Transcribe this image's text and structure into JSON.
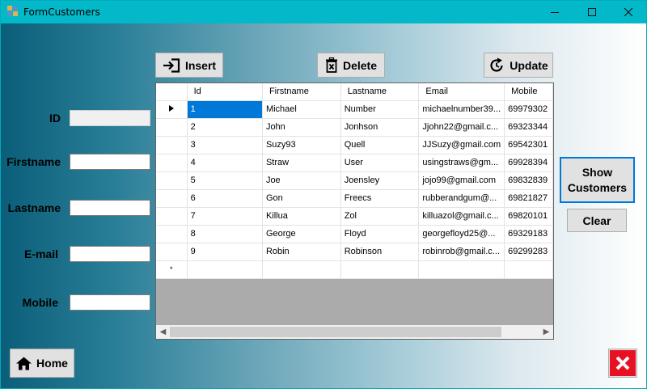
{
  "window": {
    "title": "FormCustomers",
    "accent_color": "#02b8c9",
    "controls": [
      "minimize-icon",
      "maximize-icon",
      "close-icon"
    ]
  },
  "form": {
    "labels": {
      "id": "ID",
      "firstname": "Firstname",
      "lastname": "Lastname",
      "email": "E-mail",
      "mobile": "Mobile"
    },
    "values": {
      "id": "",
      "firstname": "",
      "lastname": "",
      "email": "",
      "mobile": ""
    }
  },
  "toolbar": {
    "insert_label": "Insert",
    "delete_label": "Delete",
    "update_label": "Update"
  },
  "side": {
    "show_customers_line1": "Show",
    "show_customers_line2": "Customers",
    "clear_label": "Clear"
  },
  "footer": {
    "home_label": "Home",
    "exit_color": "#e81123"
  },
  "grid": {
    "columns": [
      "Id",
      "Firstname",
      "Lastname",
      "Email",
      "Mobile"
    ],
    "rows": [
      [
        "1",
        "Michael",
        "Number",
        "michaelnumber39...",
        "69979302"
      ],
      [
        "2",
        "John",
        "Jonhson",
        "Jjohn22@gmail.c...",
        "69323344"
      ],
      [
        "3",
        "Suzy93",
        "Quell",
        "JJSuzy@gmail.com",
        "69542301"
      ],
      [
        "4",
        "Straw",
        "User",
        "usingstraws@gm...",
        "69928394"
      ],
      [
        "5",
        "Joe",
        "Joensley",
        "jojo99@gmail.com",
        "69832839"
      ],
      [
        "6",
        "Gon",
        "Freecs",
        "rubberandgum@...",
        "69821827"
      ],
      [
        "7",
        "Killua",
        "Zol",
        "killuazol@gmail.c...",
        "69820101"
      ],
      [
        "8",
        "George",
        "Floyd",
        "georgefloyd25@...",
        "69329183"
      ],
      [
        "9",
        "Robin",
        "Robinson",
        "robinrob@gmail.c...",
        "69299283"
      ]
    ],
    "selected_row": 0,
    "new_row_marker": "*",
    "selection_color": "#0078d7"
  }
}
